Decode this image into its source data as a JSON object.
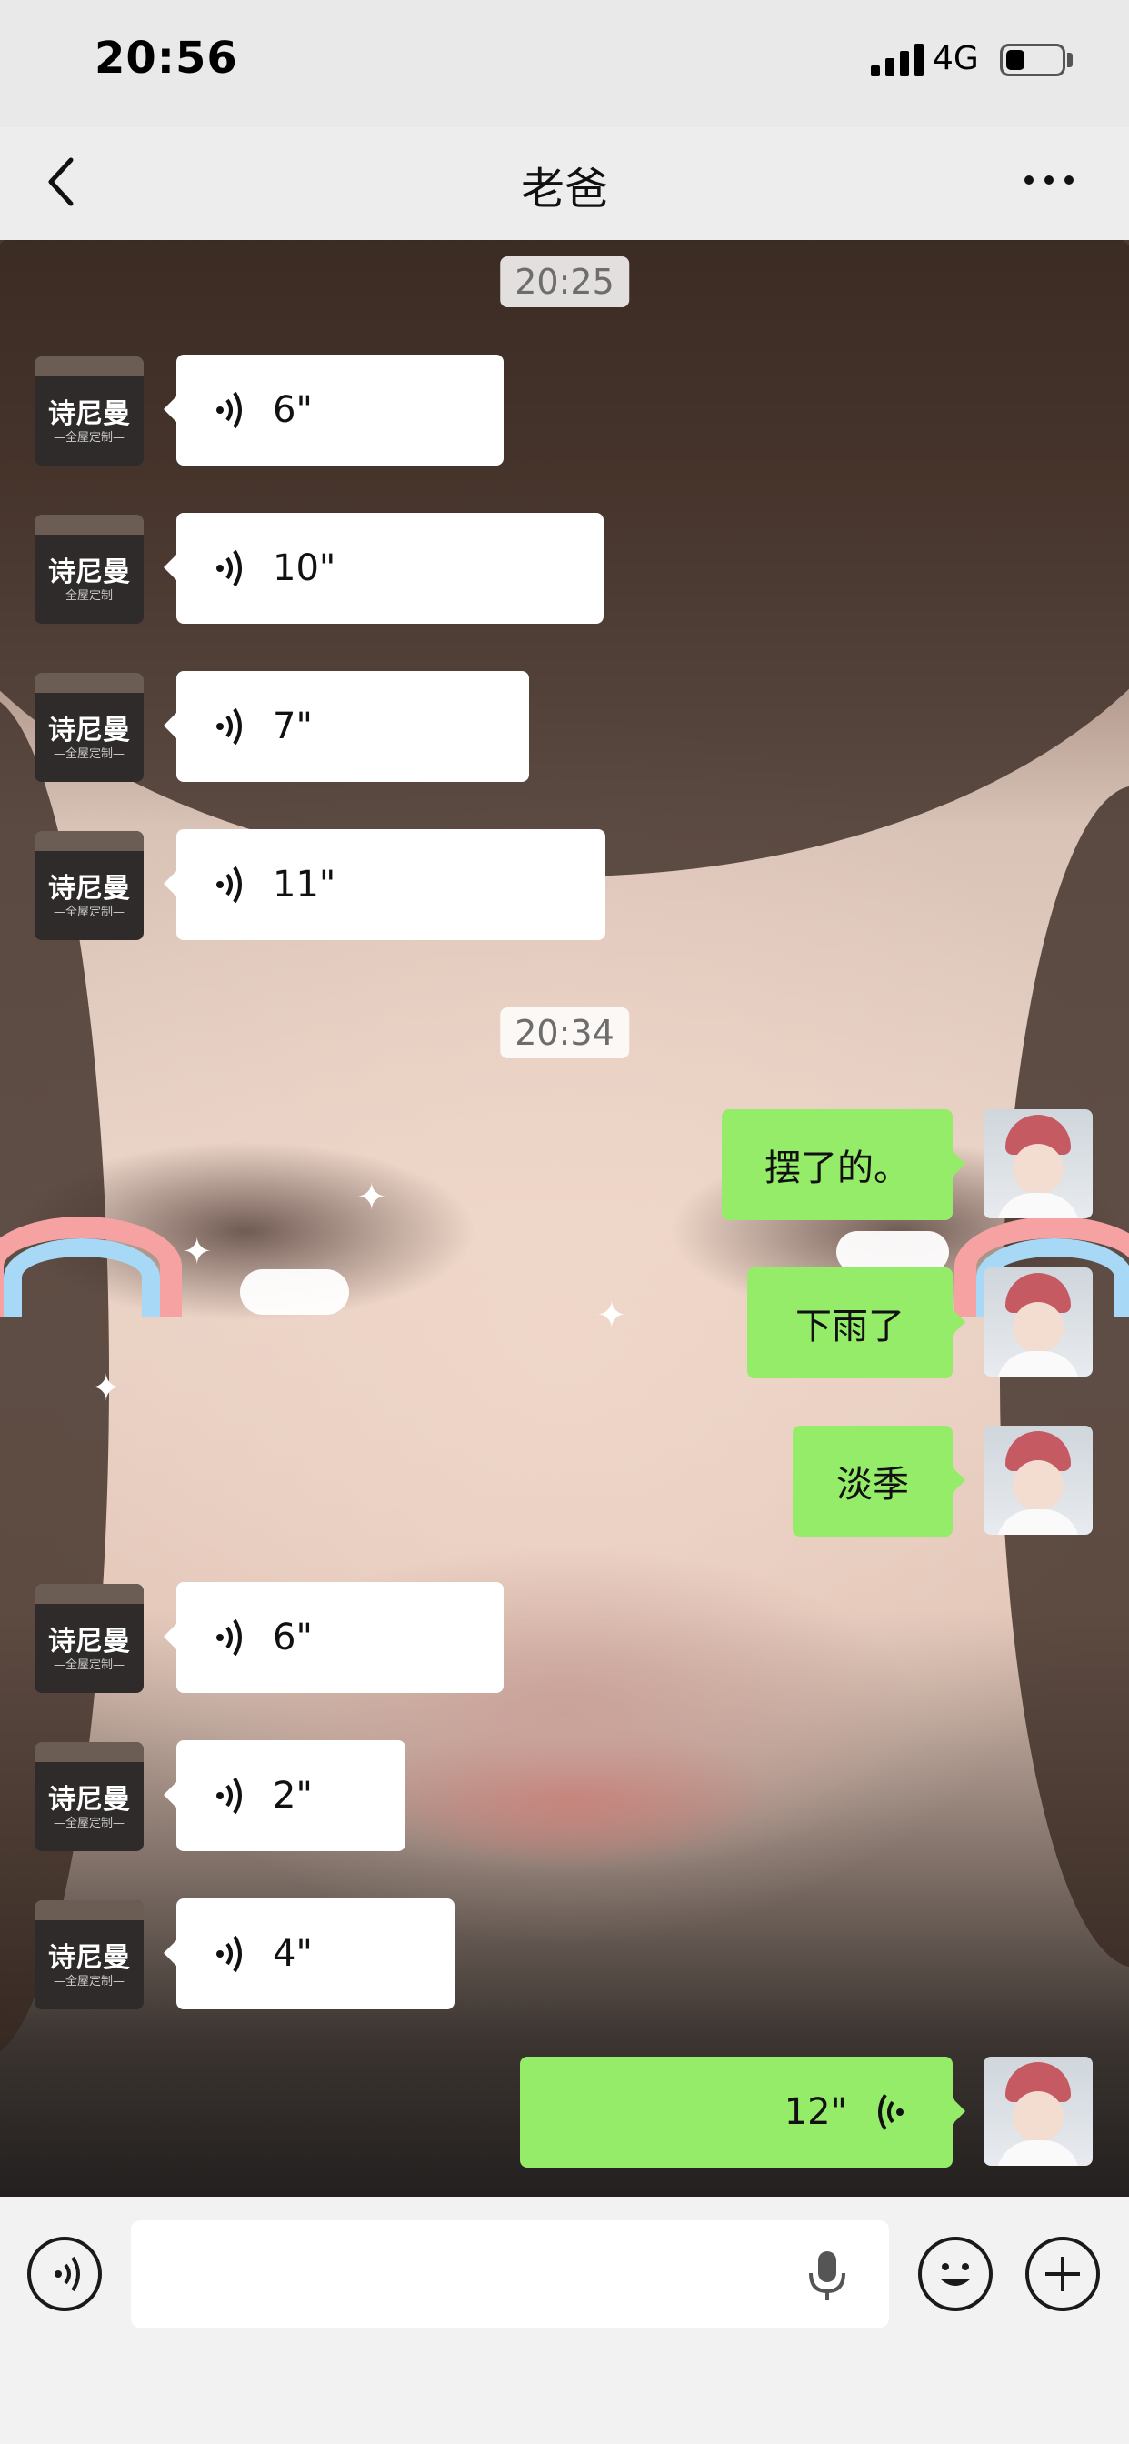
{
  "status_bar": {
    "time": "20:56",
    "network": "4G",
    "signal_bars": 4
  },
  "nav": {
    "title": "老爸",
    "back_icon": "chevron-left-icon",
    "more_icon": "more-dots-icon"
  },
  "contact": {
    "avatar_line1": "诗尼曼",
    "avatar_line2": "—全屋定制—"
  },
  "time_labels": [
    "20:25",
    "20:34"
  ],
  "messages": [
    {
      "side": "in",
      "type": "voice",
      "duration": "6\""
    },
    {
      "side": "in",
      "type": "voice",
      "duration": "10\""
    },
    {
      "side": "in",
      "type": "voice",
      "duration": "7\""
    },
    {
      "side": "in",
      "type": "voice",
      "duration": "11\""
    },
    {
      "side": "out",
      "type": "text",
      "text": "摆了的。"
    },
    {
      "side": "out",
      "type": "text",
      "text": "下雨了"
    },
    {
      "side": "out",
      "type": "text",
      "text": "淡季"
    },
    {
      "side": "in",
      "type": "voice",
      "duration": "6\""
    },
    {
      "side": "in",
      "type": "voice",
      "duration": "2\""
    },
    {
      "side": "in",
      "type": "voice",
      "duration": "4\""
    },
    {
      "side": "out",
      "type": "voice",
      "duration": "12\""
    }
  ],
  "input": {
    "placeholder": "",
    "voice_toggle_icon": "voice-toggle-icon",
    "mic_icon": "microphone-icon",
    "emoji_icon": "emoji-icon",
    "plus_icon": "plus-icon"
  },
  "colors": {
    "bubble_out": "#95ec69",
    "bubble_in": "#ffffff",
    "nav_bg": "#ededed"
  }
}
